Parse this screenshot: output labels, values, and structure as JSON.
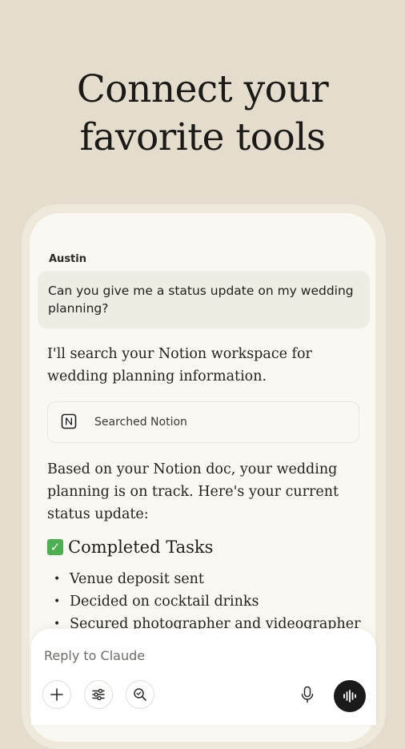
{
  "hero": {
    "line1": "Connect your",
    "line2": "favorite tools"
  },
  "conversation": {
    "user_name": "Austin",
    "user_message": "Can you give me a status update on my wedding planning?",
    "assistant_intro": "I'll search your Notion workspace for wedding planning information.",
    "tool_call": {
      "icon": "notion-icon",
      "label": "Searched Notion"
    },
    "assistant_summary": "Based on your Notion doc, your wedding planning is on track. Here's your current status update:",
    "section": {
      "emoji": "✓",
      "title": "Completed Tasks"
    },
    "tasks": [
      "Venue deposit sent",
      "Decided on cocktail drinks",
      "Secured photographer and videographer"
    ]
  },
  "composer": {
    "placeholder": "Reply to Claude",
    "buttons": [
      "add-icon",
      "sliders-icon",
      "search-icon",
      "microphone-icon",
      "voice-waveform-icon"
    ]
  },
  "colors": {
    "background": "#e4dccd",
    "screen": "#faf8f3",
    "user_bubble": "#efece4",
    "voice_button": "#1a1a1a",
    "check_green": "#4caf50"
  }
}
